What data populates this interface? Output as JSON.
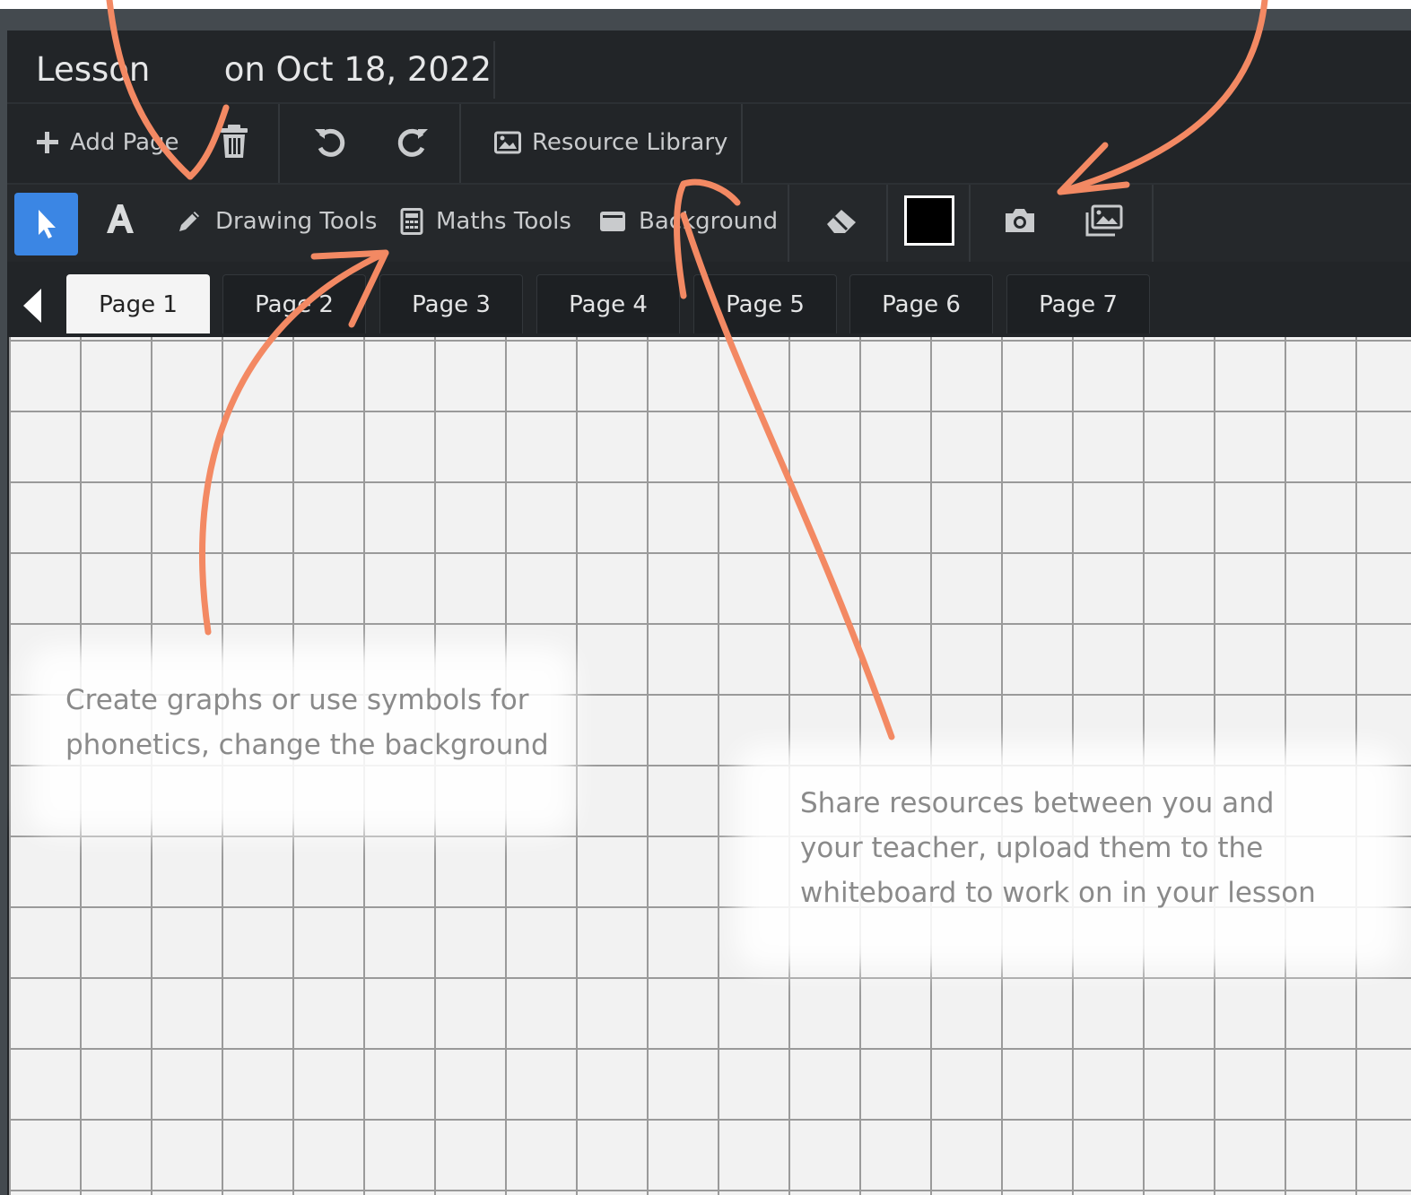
{
  "lesson": {
    "title": "Lesson       on Oct 18, 2022"
  },
  "toolbar": {
    "add_page": "Add Page",
    "resource_library": "Resource Library"
  },
  "tools": {
    "drawing_tools": "Drawing Tools",
    "maths_tools": "Maths Tools",
    "background": "Background"
  },
  "tabs": [
    "Page 1",
    "Page 2",
    "Page 3",
    "Page 4",
    "Page 5",
    "Page 6",
    "Page 7"
  ],
  "notes": {
    "left_line1": "Create graphs or use symbols for",
    "left_line2": "phonetics, change the background",
    "right_line1": "Share resources between you and",
    "right_line2": "your teacher, upload them to the",
    "right_line3": "whiteboard to work on in your lesson"
  },
  "colors": {
    "accent": "#3b86e4",
    "annotation_arrow": "#f38963",
    "selected_color": "#000000"
  }
}
